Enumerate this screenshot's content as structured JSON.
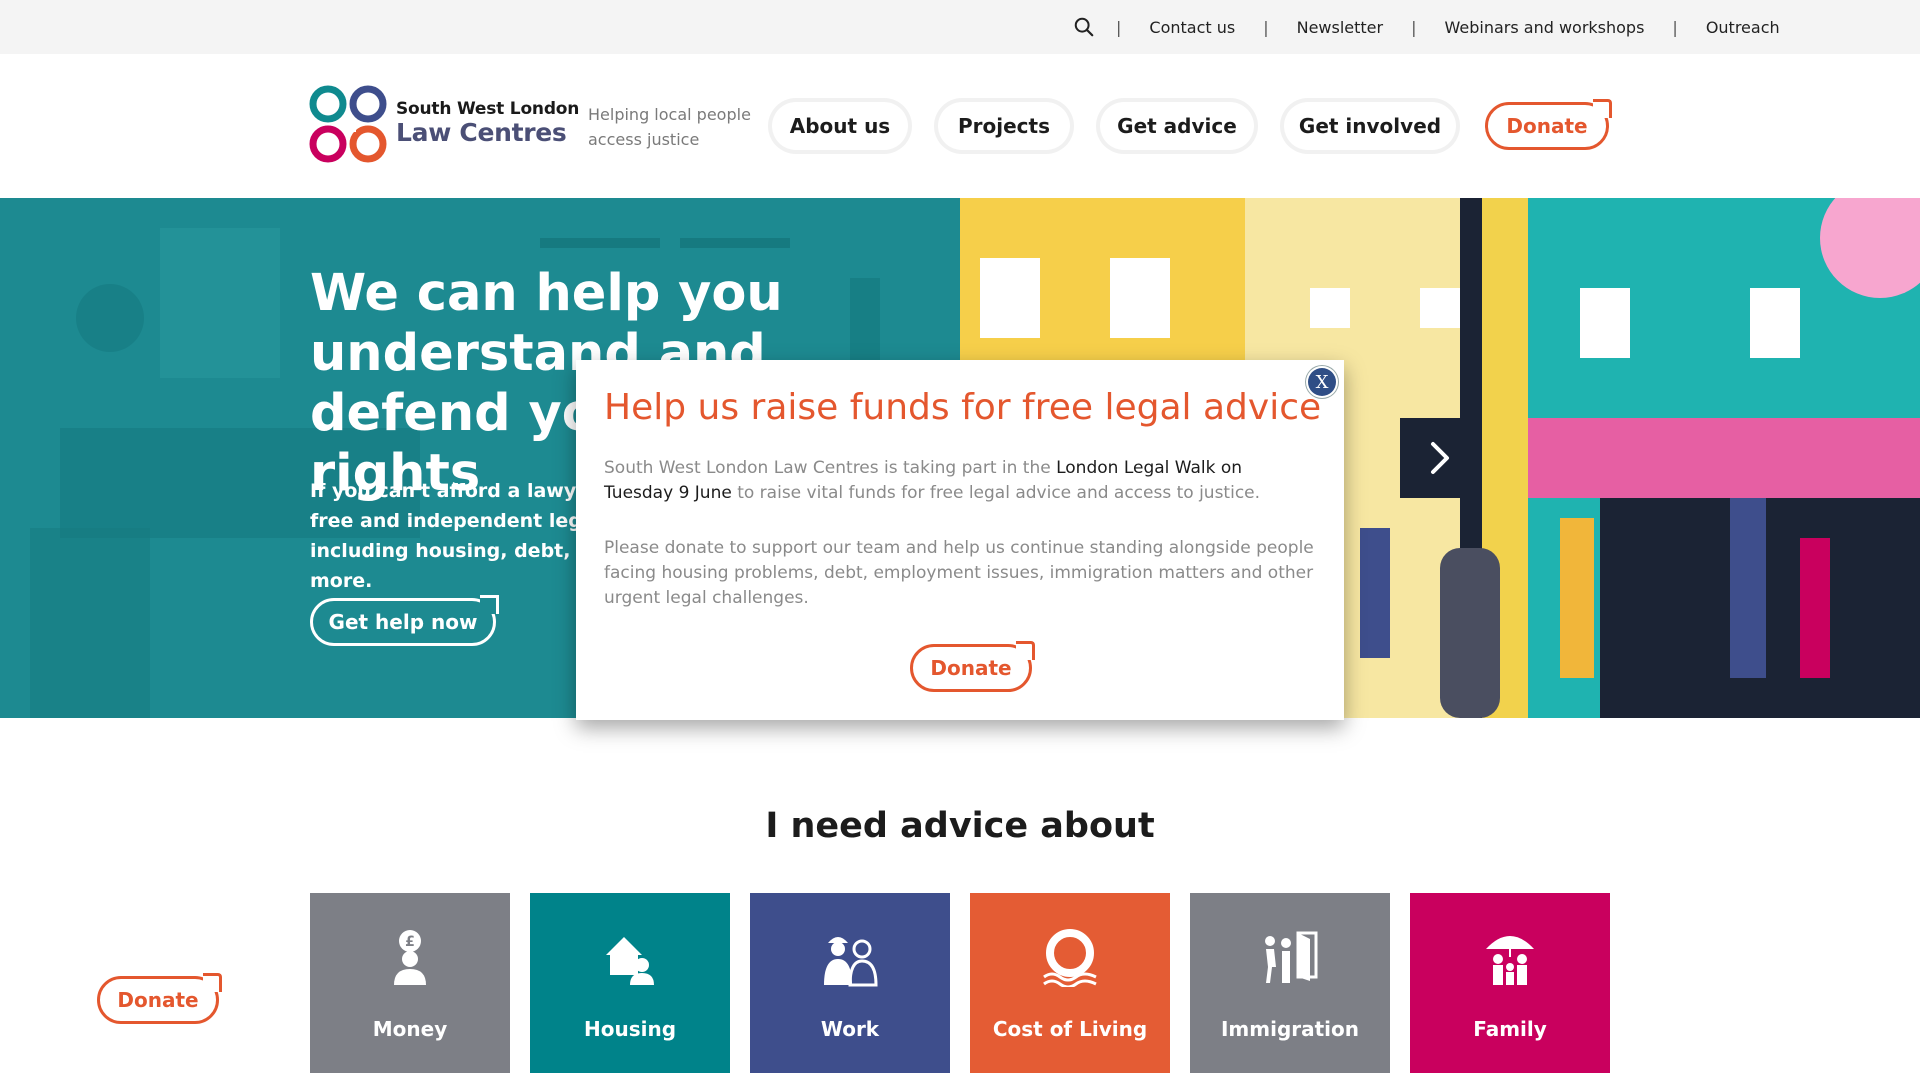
{
  "utility_bar": {
    "search_icon": "search-icon",
    "links": [
      "Contact us",
      "Newsletter",
      "Webinars and workshops",
      "Outreach"
    ]
  },
  "header": {
    "logo_line1": "South West London",
    "logo_line2": "Law Centres",
    "tagline": "Helping local people access justice",
    "nav": [
      "About us",
      "Projects",
      "Get advice",
      "Get involved"
    ],
    "donate_label": "Donate"
  },
  "hero": {
    "heading": "We can help you understand and defend your rights",
    "text": "If you can't afford a lawyer, we can give you free and independent legal advice and help including housing, debt, immigration and more.",
    "cta_label": "Get help now",
    "next_icon": "chevron-right-icon"
  },
  "modal": {
    "close_label": "X",
    "title": "Help us raise funds for free legal advice",
    "p1_before": "South West London Law Centres is taking part in the ",
    "p1_highlight": "London Legal Walk on Tuesday 9 June",
    "p1_after": " to raise vital funds for free legal advice and access to justice.",
    "p2": "Please donate to support our team and help us continue standing alongside people facing housing problems, debt, employment issues, immigration matters and other urgent legal challenges.",
    "donate_label": "Donate"
  },
  "advice": {
    "title": "I need advice about",
    "tiles": [
      {
        "label": "Money",
        "color": "#7d7f86",
        "icon": "money-icon"
      },
      {
        "label": "Housing",
        "color": "#00838a",
        "icon": "housing-icon"
      },
      {
        "label": "Work",
        "color": "#3e4e8c",
        "icon": "work-icon"
      },
      {
        "label": "Cost of Living",
        "color": "#e45c34",
        "icon": "lifebuoy-icon"
      },
      {
        "label": "Immigration",
        "color": "#7d7f86",
        "icon": "immigration-icon"
      },
      {
        "label": "Family",
        "color": "#c9005e",
        "icon": "family-icon"
      }
    ]
  },
  "floating_donate_label": "Donate",
  "colors": {
    "accent": "#e4572e",
    "teal": "#1d8a91"
  }
}
